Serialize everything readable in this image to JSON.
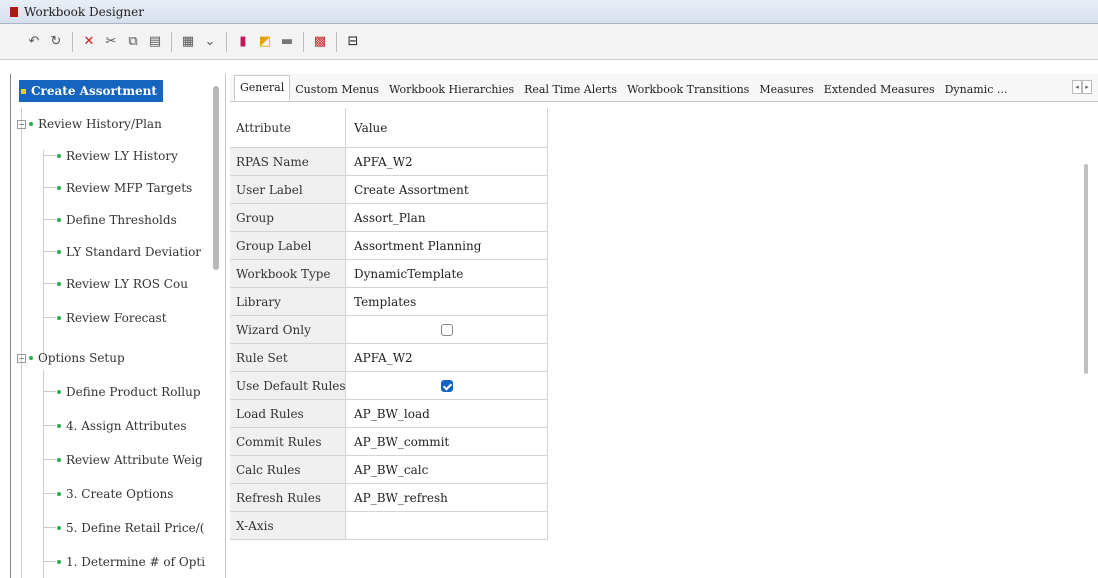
{
  "window": {
    "title": "Workbook Designer"
  },
  "toolbar": {
    "icons": [
      "undo-icon",
      "redo-icon",
      "delete-icon",
      "cut-icon",
      "copy-icon",
      "paste-icon",
      "grid-icon",
      "dropdown-icon",
      "red-bar-icon",
      "folder-chart-icon",
      "table-icon",
      "palette-chart-icon",
      "collapse-icon"
    ]
  },
  "tree": {
    "root": "Create Assortment",
    "groups": [
      {
        "label": "Review History/Plan",
        "children": [
          "Review LY History",
          "Review MFP Targets",
          "Define Thresholds",
          "LY Standard Deviatior",
          "Review LY ROS Cou",
          "Review Forecast"
        ]
      },
      {
        "label": "Options Setup",
        "children": [
          "Define Product Rollup",
          "4. Assign Attributes",
          "Review Attribute Weig",
          "3. Create Options",
          "5. Define Retail Price/(",
          "1. Determine # of Opti"
        ]
      }
    ]
  },
  "tabs": [
    "General",
    "Custom Menus",
    "Workbook Hierarchies",
    "Real Time Alerts",
    "Workbook Transitions",
    "Measures",
    "Extended Measures",
    "Dynamic ..."
  ],
  "active_tab": "General",
  "grid": {
    "header": {
      "attribute": "Attribute",
      "value": "Value"
    },
    "rows": [
      {
        "attribute": "RPAS Name",
        "value": "APFA_W2"
      },
      {
        "attribute": "User Label",
        "value": "Create Assortment"
      },
      {
        "attribute": "Group",
        "value": "Assort_Plan"
      },
      {
        "attribute": "Group Label",
        "value": "Assortment Planning"
      },
      {
        "attribute": "Workbook Type",
        "value": "DynamicTemplate"
      },
      {
        "attribute": "Library",
        "value": "Templates"
      },
      {
        "attribute": "Wizard Only",
        "value": "",
        "checkbox": false
      },
      {
        "attribute": "Rule Set",
        "value": "APFA_W2"
      },
      {
        "attribute": "Use Default Rules",
        "value": "",
        "checkbox": true
      },
      {
        "attribute": "Load Rules",
        "value": "AP_BW_load"
      },
      {
        "attribute": "Commit Rules",
        "value": "AP_BW_commit"
      },
      {
        "attribute": "Calc Rules",
        "value": "AP_BW_calc"
      },
      {
        "attribute": "Refresh Rules",
        "value": "AP_BW_refresh"
      },
      {
        "attribute": "X-Axis",
        "value": ""
      }
    ]
  },
  "colors": {
    "selection": "#1565c0",
    "bullet": "#22b14c",
    "root_bullet": "#f5d000"
  }
}
